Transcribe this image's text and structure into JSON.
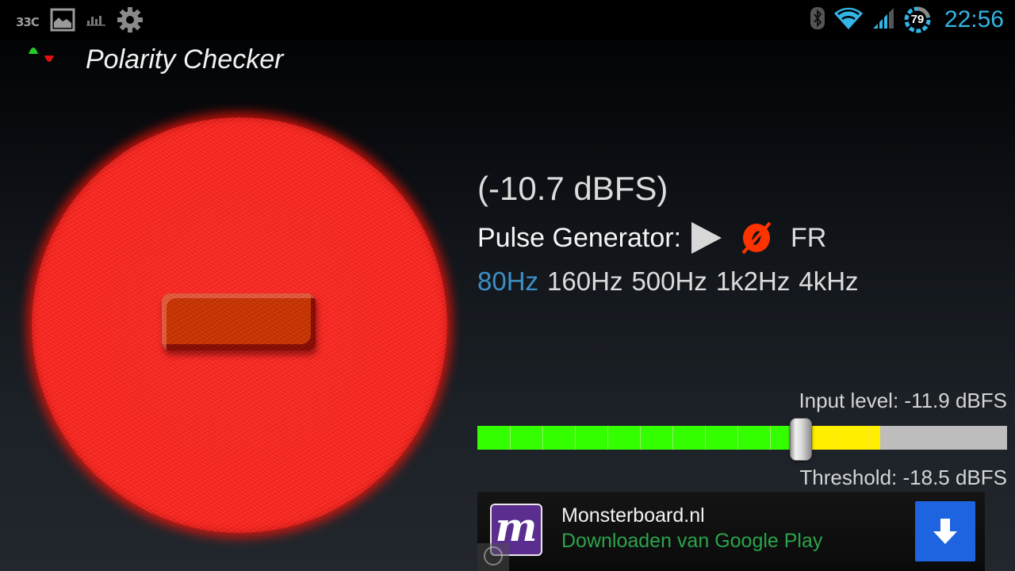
{
  "status_bar": {
    "left_icons": [
      {
        "name": "temperature-indicator",
        "text": "33C"
      },
      {
        "name": "gallery-icon"
      },
      {
        "name": "chart-icon"
      },
      {
        "name": "settings-gear-icon"
      }
    ],
    "right_icons": [
      "bluetooth-icon",
      "wifi-icon",
      "signal-icon",
      "battery-icon"
    ],
    "battery_percent": "79",
    "clock": "22:56",
    "accent_color": "#33b5e5"
  },
  "app": {
    "title": "Polarity Checker",
    "logo_colors": {
      "positive": "#22cc22",
      "negative": "#dd1111"
    }
  },
  "polarity_indicator": {
    "state": "negative",
    "symbol": "minus",
    "color": "#ff2620"
  },
  "measurement": {
    "level_readout": "(-10.7 dBFS)"
  },
  "pulse_generator": {
    "label": "Pulse Generator:",
    "play_icon": "play-icon",
    "phase_icon": "phase-invert-icon",
    "phase_color": "#ff3300",
    "mode_label": "FR"
  },
  "frequencies": {
    "options": [
      "80Hz",
      "160Hz",
      "500Hz",
      "1k2Hz",
      "4kHz"
    ],
    "selected": "80Hz",
    "selected_color": "#3d8fc6"
  },
  "input_meter": {
    "label": "Input level: -11.9 dBFS",
    "level_fraction": 0.76,
    "threshold_fraction": 0.61,
    "segments": 16,
    "colors": {
      "green": "#33ff00",
      "yellow": "#ffee00",
      "empty": "#bdbdbd"
    },
    "threshold_label": "Threshold: -18.5 dBFS"
  },
  "ad": {
    "icon_letter": "m",
    "title": "Monsterboard.nl",
    "subtitle": "Downloaden van Google Play",
    "download_icon": "download-arrow-icon"
  }
}
